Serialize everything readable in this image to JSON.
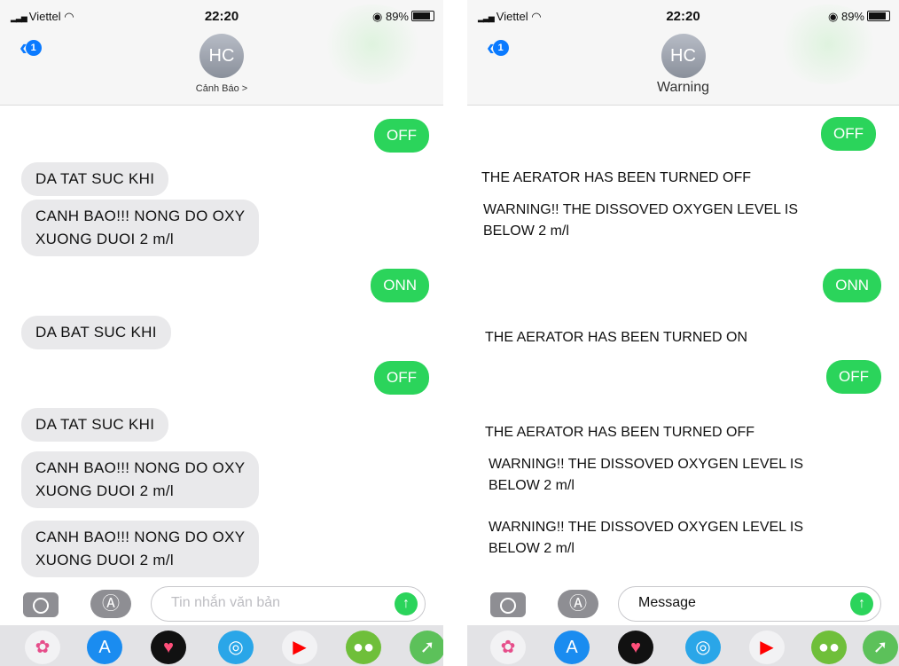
{
  "status": {
    "carrier": "Viettel",
    "time": "22:20",
    "battery": "89%"
  },
  "left": {
    "back_badge": "1",
    "avatar": "HC",
    "contact": "Cảnh Báo >",
    "messages": [
      {
        "dir": "out",
        "text": "OFF"
      },
      {
        "dir": "in",
        "text": "DA TAT SUC KHI"
      },
      {
        "dir": "in",
        "line1": "CANH BAO!!! NONG DO OXY",
        "line2": "XUONG DUOI 2 m/l"
      },
      {
        "dir": "out",
        "text": "ONN"
      },
      {
        "dir": "in",
        "text": "DA BAT SUC KHI"
      },
      {
        "dir": "out",
        "text": "OFF"
      },
      {
        "dir": "in",
        "text": "DA TAT SUC KHI"
      },
      {
        "dir": "in",
        "line1": "CANH BAO!!! NONG DO OXY",
        "line2": "XUONG DUOI 2 m/l"
      },
      {
        "dir": "in",
        "line1": "CANH BAO!!! NONG DO OXY",
        "line2": "XUONG DUOI 2 m/l"
      }
    ],
    "placeholder": "Tin nhắn văn bản"
  },
  "right": {
    "back_badge": "1",
    "avatar": "HC",
    "contact": "Warning",
    "messages": [
      {
        "dir": "out",
        "text": "OFF"
      },
      {
        "dir": "in",
        "text": "THE AERATOR HAS BEEN TURNED OFF"
      },
      {
        "dir": "in",
        "line1": "WARNING!! THE DISSOVED OXYGEN LEVEL IS",
        "line2": "BELOW 2 m/l"
      },
      {
        "dir": "out",
        "text": "ONN"
      },
      {
        "dir": "in",
        "text": "THE AERATOR HAS BEEN TURNED ON"
      },
      {
        "dir": "out",
        "text": "OFF"
      },
      {
        "dir": "in",
        "text": "THE AERATOR HAS BEEN TURNED OFF"
      },
      {
        "dir": "in",
        "line1": "WARNING!! THE DISSOVED OXYGEN LEVEL IS",
        "line2": "BELOW 2 m/l"
      },
      {
        "dir": "in",
        "line1": "WARNING!! THE DISSOVED OXYGEN LEVEL IS",
        "line2": "BELOW 2 m/l"
      }
    ],
    "placeholder": "Message"
  },
  "dock_icons": [
    {
      "name": "photos-icon",
      "color": "#f2f2f4"
    },
    {
      "name": "app-store-icon",
      "color": "#1a8cf0"
    },
    {
      "name": "digital-touch-icon",
      "color": "#111111"
    },
    {
      "name": "camera-effects-icon",
      "color": "#2aa6e8"
    },
    {
      "name": "youtube-icon",
      "color": "#f2f2f4"
    },
    {
      "name": "game-icon",
      "color": "#6fbf3a"
    },
    {
      "name": "maps-icon",
      "color": "#5cc15a"
    }
  ]
}
